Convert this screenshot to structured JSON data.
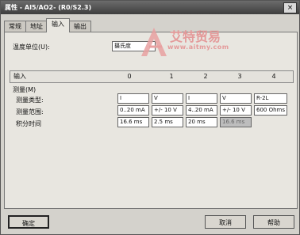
{
  "window": {
    "title": "属性 - AI5/AO2- (R0/S2.3)",
    "close_label": "×"
  },
  "tabs": [
    "常规",
    "地址",
    "输入",
    "输出"
  ],
  "temperature": {
    "label": "温度单位(U):",
    "value": "摄氏度"
  },
  "grid": {
    "header": [
      "输入",
      "0",
      "1",
      "2",
      "3",
      "4"
    ],
    "section": "测量(M)",
    "rows": [
      {
        "label": "测量类型:",
        "values": [
          "I",
          "V",
          "I",
          "V",
          "R-2L"
        ]
      },
      {
        "label": "测量范围:",
        "values": [
          "0..20 mA",
          "+/- 10 V",
          "4..20 mA",
          "+/- 10 V",
          "600 Ohms"
        ]
      },
      {
        "label": "积分时间",
        "values": [
          "16.6 ms",
          "2.5 ms",
          "20 ms",
          "16.6 ms",
          ""
        ]
      }
    ]
  },
  "buttons": {
    "ok": "确定",
    "cancel": "取消",
    "help": "帮助"
  },
  "watermark": {
    "brand": "艾特贸易",
    "url": "www.aitmy.com"
  }
}
